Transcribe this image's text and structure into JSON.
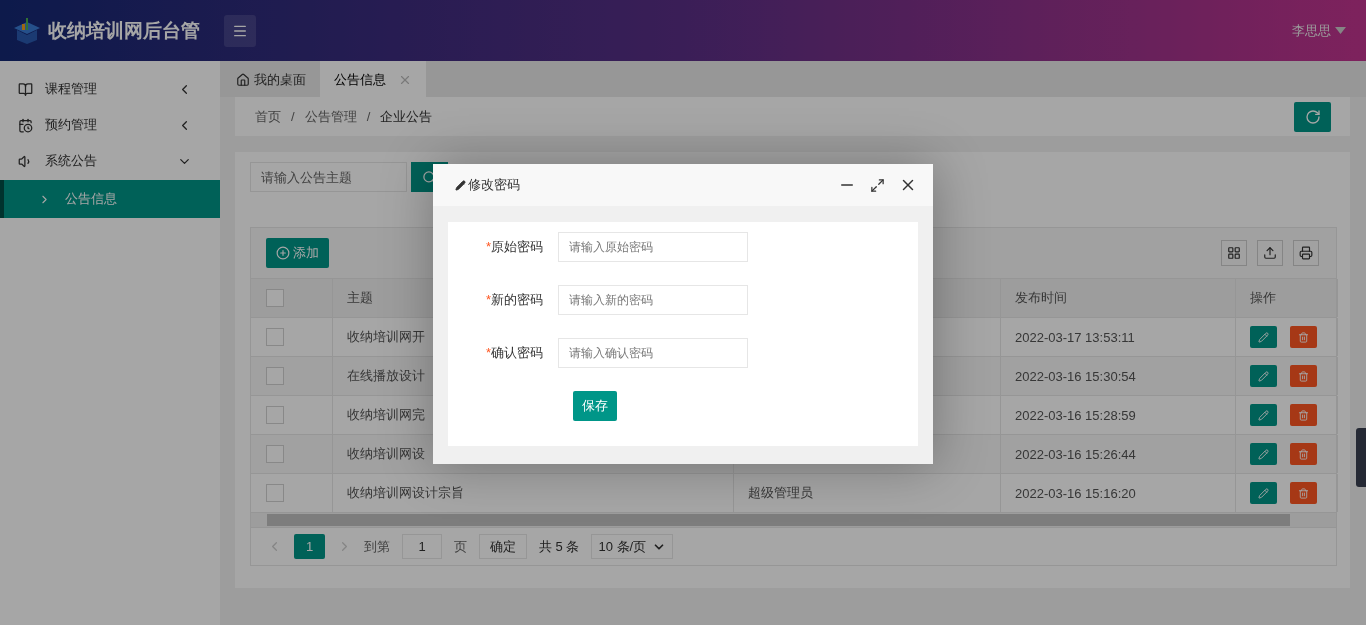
{
  "header": {
    "title": "收纳培训网后台管",
    "user": "李思思"
  },
  "sidebar": {
    "items": [
      {
        "label": "课程管理",
        "kind": "book",
        "expanded": false,
        "selected": false
      },
      {
        "label": "预约管理",
        "kind": "calendar",
        "expanded": false,
        "selected": false
      },
      {
        "label": "系统公告",
        "kind": "speaker",
        "expanded": true,
        "selected": false,
        "children": [
          {
            "label": "公告信息",
            "selected": true
          }
        ]
      }
    ]
  },
  "tabs": [
    {
      "label": "我的桌面",
      "selected": false,
      "closable": false,
      "kind": "home"
    },
    {
      "label": "公告信息",
      "selected": true,
      "closable": true,
      "kind": "page"
    }
  ],
  "breadcrumb": {
    "separator": "/",
    "items": [
      "首页",
      "公告管理",
      "企业公告"
    ]
  },
  "search": {
    "placeholder": "请输入公告主题"
  },
  "toolbar": {
    "add_button": "添加"
  },
  "table": {
    "header_checked": false,
    "columns": {
      "subject": "主题",
      "published": "发布时间",
      "actions": "操作"
    },
    "rows": [
      {
        "checked": false,
        "subject": "收纳培训网开",
        "published": "2022-03-17 13:53:11"
      },
      {
        "checked": false,
        "subject": "在线播放设计",
        "published": "2022-03-16 15:30:54"
      },
      {
        "checked": false,
        "subject": "收纳培训网完",
        "published": "2022-03-16 15:28:59"
      },
      {
        "checked": false,
        "subject": "收纳培训网设",
        "published": "2022-03-16 15:26:44"
      },
      {
        "checked": false,
        "subject": "收纳培训网设计宗旨",
        "column_3": "超级管理员",
        "published": "2022-03-16 15:16:20"
      }
    ]
  },
  "pagination": {
    "pages": [
      {
        "label": "1",
        "selected": true
      }
    ],
    "goto_label": "到第",
    "goto_value": "1",
    "page_suffix": "页",
    "confirm": "确定",
    "total": "共 5 条",
    "page_size": "10 条/页"
  },
  "modal": {
    "title": "修改密码",
    "fields": [
      {
        "required_mark": "*",
        "label": "原始密码",
        "placeholder": "请输入原始密码"
      },
      {
        "required_mark": "*",
        "label": "新的密码",
        "placeholder": "请输入新的密码"
      },
      {
        "required_mark": "*",
        "label": "确认密码",
        "placeholder": "请输入确认密码"
      }
    ],
    "save": "保存"
  }
}
